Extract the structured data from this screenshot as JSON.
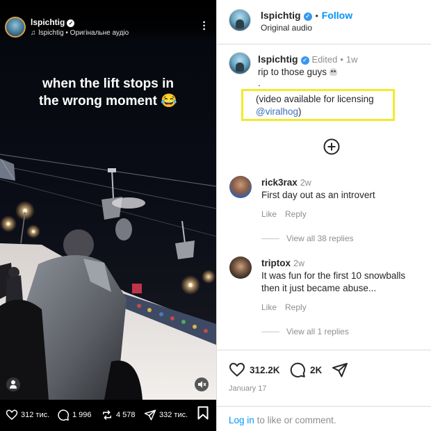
{
  "video": {
    "username": "lspichtig",
    "audio_label": "lspichtig • Оригінальне аудіо",
    "caption_line1": "when the lift stops in",
    "caption_line2": "the wrong moment 😂",
    "stats": {
      "likes": "312 тис.",
      "comments": "1 996",
      "reposts": "4 578",
      "shares": "332 тис."
    },
    "icons": [
      "verified-icon",
      "music-note-icon",
      "more-options-icon",
      "person-tag-icon",
      "mute-icon",
      "heart-icon",
      "comment-icon",
      "repost-icon",
      "share-icon",
      "bookmark-icon"
    ]
  },
  "post": {
    "header": {
      "username": "lspichtig",
      "follow_label": "Follow",
      "dot": "•",
      "audio": "Original audio"
    },
    "caption": {
      "username": "lspichtig",
      "edited": "Edited",
      "time": "1w",
      "line1": "rip to those guys",
      "line2": ".",
      "line3": "(video available for licensing",
      "link": "@viralhog",
      "close_paren": ")"
    },
    "comments": [
      {
        "username": "rick3rax",
        "time": "2w",
        "text": [
          "First day out as an introvert"
        ],
        "like": "Like",
        "reply": "Reply",
        "view_replies": "View all 38 replies"
      },
      {
        "username": "triptox",
        "time": "2w",
        "text": [
          "It was fun for the first 10 snowballs",
          "then it just became abuse..."
        ],
        "like": "Like",
        "reply": "Reply",
        "view_replies": "View all 1 replies"
      }
    ],
    "actions": {
      "likes": "312.2K",
      "comments": "2K"
    },
    "date": "January 17",
    "login": {
      "link": "Log in",
      "text": "to like or comment."
    },
    "colors": {
      "accent_blue": "#0095f6",
      "highlight_box": "#f2ea2a",
      "muted_text": "#8e8e8e"
    }
  }
}
